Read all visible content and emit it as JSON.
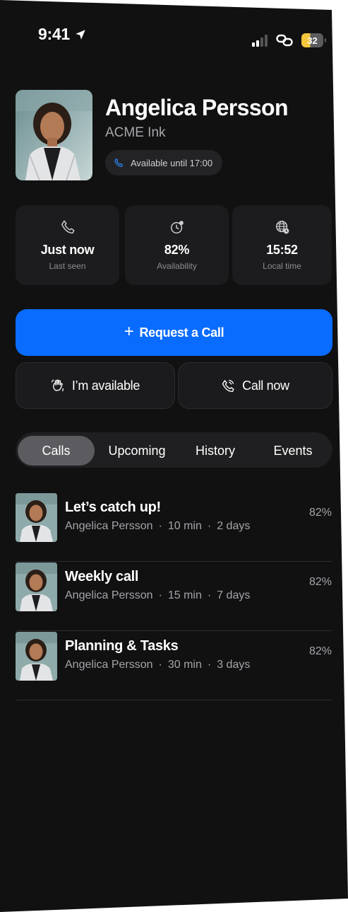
{
  "status_bar": {
    "time": "9:41",
    "battery": "32"
  },
  "profile": {
    "name": "Angelica Persson",
    "company": "ACME Ink",
    "availability": "Available until 17:00"
  },
  "stats": [
    {
      "icon": "phone-icon",
      "value": "Just now",
      "label": "Last seen"
    },
    {
      "icon": "clock-icon",
      "value": "82%",
      "label": "Availability"
    },
    {
      "icon": "globe-icon",
      "value": "15:52",
      "label": "Local time"
    }
  ],
  "actions": {
    "request_call": "Request a Call",
    "available": "I’m available",
    "call_now": "Call now"
  },
  "tabs": [
    {
      "label": "Calls",
      "active": true
    },
    {
      "label": "Upcoming",
      "active": false
    },
    {
      "label": "History",
      "active": false
    },
    {
      "label": "Events",
      "active": false
    }
  ],
  "calls": [
    {
      "title": "Let’s catch up!",
      "person": "Angelica Persson",
      "duration": "10 min",
      "when": "2 days",
      "percent": "82%"
    },
    {
      "title": "Weekly call",
      "person": "Angelica Persson",
      "duration": "15 min",
      "when": "7 days",
      "percent": "82%"
    },
    {
      "title": "Planning & Tasks",
      "person": "Angelica Persson",
      "duration": "30 min",
      "when": "3 days",
      "percent": "82%"
    }
  ],
  "colors": {
    "background": "#111112",
    "accent": "#0a6cff",
    "battery": "#f5c63c"
  }
}
